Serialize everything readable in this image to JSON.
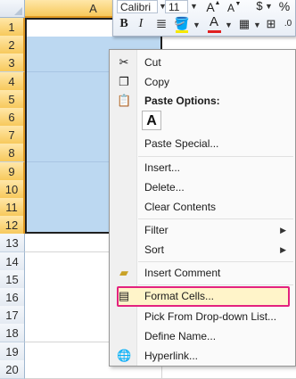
{
  "sheet": {
    "column_a": "A",
    "rows": [
      "1",
      "2",
      "3",
      "4",
      "5",
      "6",
      "7",
      "8",
      "9",
      "10",
      "11",
      "12",
      "13",
      "14",
      "15",
      "16",
      "17",
      "18",
      "19",
      "20"
    ],
    "selected_rows": 12
  },
  "mini_toolbar": {
    "font_name": "Calibri",
    "font_size": "11",
    "grow_font": "A",
    "shrink_font": "A",
    "percent": "%",
    "bold": "B",
    "italic": "I",
    "font_color_letter": "A",
    "font_color": "#e02020",
    "fill_color": "#f6e800"
  },
  "context_menu": {
    "items": [
      {
        "label": "Cut",
        "icon": "scissors-icon"
      },
      {
        "label": "Copy",
        "icon": "copy-icon"
      },
      {
        "label": "Paste Options:",
        "icon": "paste-icon"
      },
      {
        "label": "A",
        "icon": "paste-values-icon"
      },
      {
        "label": "Paste Special...",
        "icon": ""
      },
      {
        "label": "Insert...",
        "icon": ""
      },
      {
        "label": "Delete...",
        "icon": ""
      },
      {
        "label": "Clear Contents",
        "icon": ""
      },
      {
        "label": "Filter",
        "icon": ""
      },
      {
        "label": "Sort",
        "icon": ""
      },
      {
        "label": "Insert Comment",
        "icon": "comment-icon"
      },
      {
        "label": "Format Cells...",
        "icon": "format-cells-icon"
      },
      {
        "label": "Pick From Drop-down List...",
        "icon": ""
      },
      {
        "label": "Define Name...",
        "icon": ""
      },
      {
        "label": "Hyperlink...",
        "icon": "hyperlink-icon"
      }
    ],
    "highlight_color": "#e3227f"
  }
}
